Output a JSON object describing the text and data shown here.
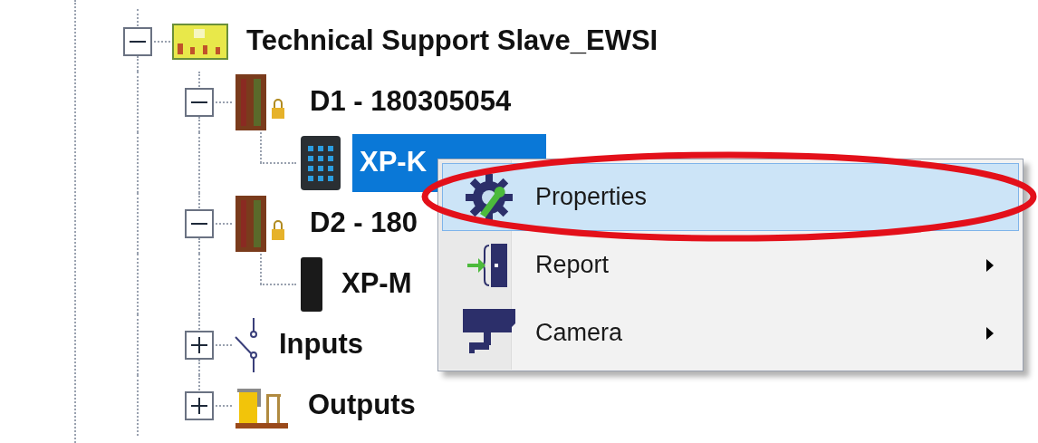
{
  "tree": {
    "items": [
      {
        "label": "Technical Support Slave_EWSI",
        "kind": "site",
        "expanded": true,
        "selected": false,
        "children": [
          {
            "label": "D1 - 180305054",
            "kind": "door",
            "expanded": true,
            "selected": false,
            "children": [
              {
                "label": "XP-K",
                "kind": "keypad",
                "selected": true
              }
            ]
          },
          {
            "label": "D2 - 180",
            "kind": "door",
            "expanded": true,
            "selected": false,
            "children": [
              {
                "label": "XP-M",
                "kind": "reader",
                "selected": false
              }
            ]
          },
          {
            "label": "Inputs",
            "kind": "switch",
            "expanded": false,
            "selected": false
          },
          {
            "label": "Outputs",
            "kind": "relay",
            "expanded": false,
            "selected": false
          }
        ]
      }
    ]
  },
  "context_menu": {
    "items": [
      {
        "label": "Properties",
        "kind": "gear",
        "selected": true,
        "submenu": false
      },
      {
        "label": "Report",
        "kind": "report",
        "selected": false,
        "submenu": true
      },
      {
        "label": "Camera",
        "kind": "camera",
        "selected": false,
        "submenu": true
      }
    ]
  },
  "annotation": {
    "kind": "ellipse"
  }
}
